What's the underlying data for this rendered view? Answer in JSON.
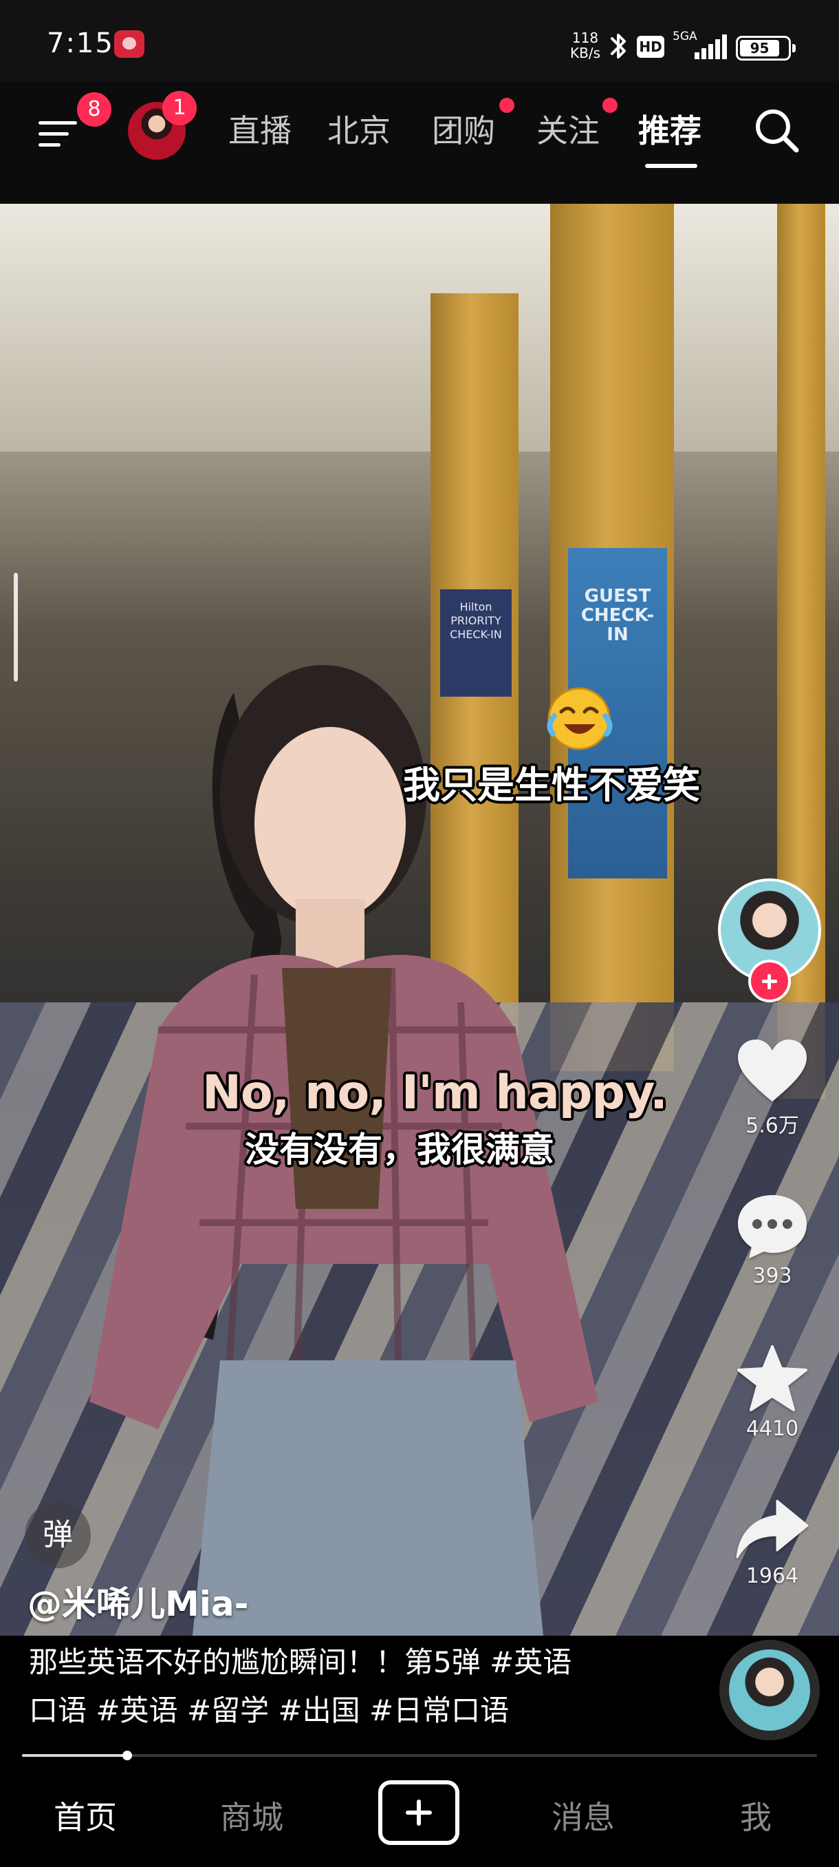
{
  "status_bar": {
    "time": "7:15",
    "net_speed_value": "118",
    "net_speed_unit": "KB/s",
    "hd": "HD",
    "signal_label": "5GA",
    "battery": "95"
  },
  "top_nav": {
    "menu_badge": "8",
    "avatar_badge": "1",
    "tabs": [
      {
        "label": "直播",
        "dot": false
      },
      {
        "label": "北京",
        "dot": false
      },
      {
        "label": "团购",
        "dot": true
      },
      {
        "label": "关注",
        "dot": true
      },
      {
        "label": "推荐",
        "dot": false,
        "active": true
      }
    ]
  },
  "video": {
    "sign_guest": "GUEST CHECK-IN",
    "sign_hilton": "Hilton PRIORITY CHECK-IN",
    "caption_top": "我只是生性不爱笑",
    "caption_en": "No, no, I'm happy.",
    "caption_zh": "没有没有，我很满意",
    "progress_fraction": 0.132
  },
  "actions": {
    "likes": "5.6万",
    "comments": "393",
    "favorites": "4410",
    "shares": "1964"
  },
  "danmaku_label": "弹",
  "author": "@米唏儿Mia-",
  "description_line1": "那些英语不好的尴尬瞬间！！第5弹 #英语",
  "description_line2": "口语 #英语 #留学 #出国 #日常口语",
  "bottom_nav": {
    "home": "首页",
    "mall": "商城",
    "messages": "消息",
    "me": "我"
  },
  "colors": {
    "accent": "#fe2c55",
    "background": "#000000"
  },
  "icons": [
    "menu-icon",
    "search-icon",
    "heart-icon",
    "comment-icon",
    "star-icon",
    "share-icon",
    "plus-icon",
    "bluetooth-icon",
    "battery-icon"
  ]
}
